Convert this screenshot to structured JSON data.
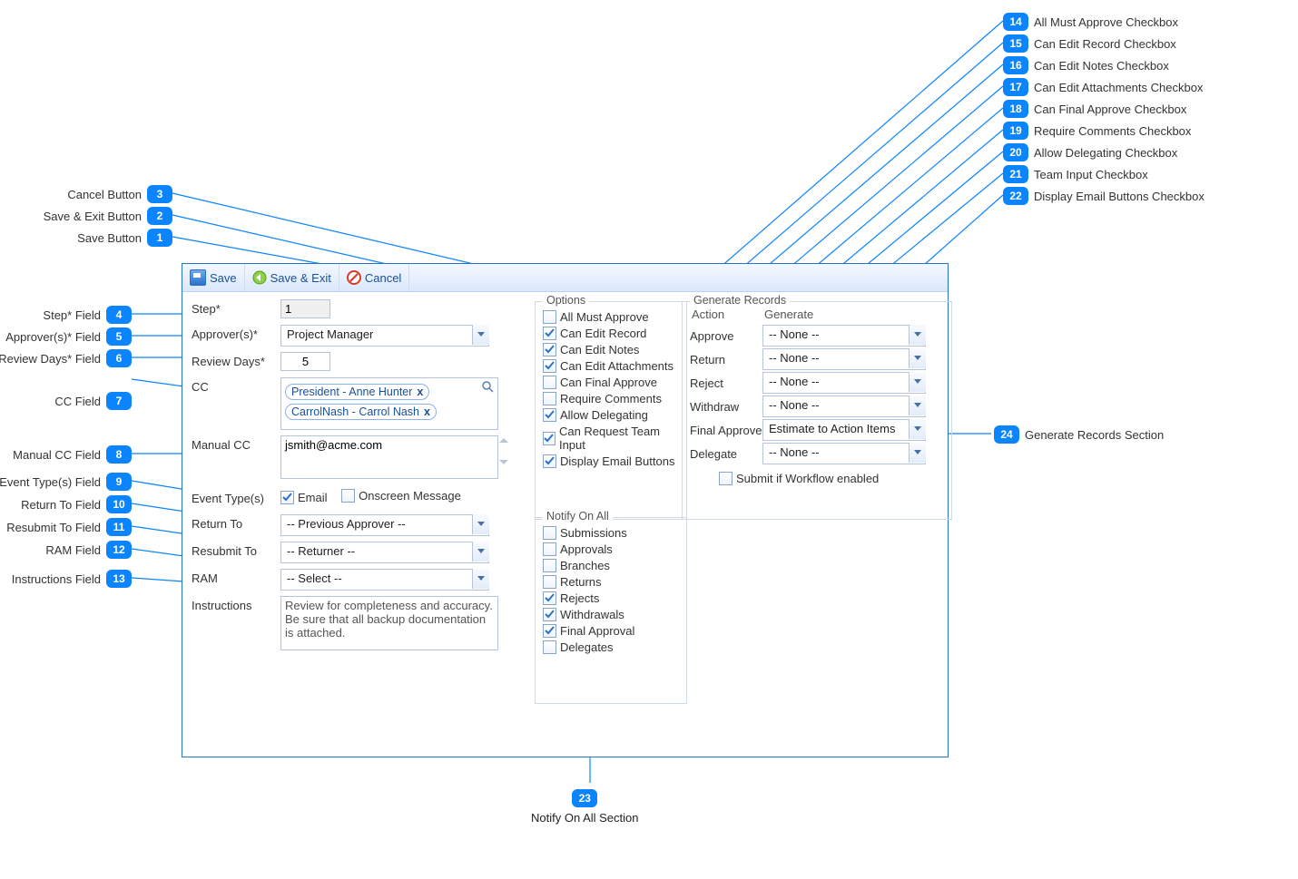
{
  "toolbar": {
    "save": "Save",
    "save_exit": "Save & Exit",
    "cancel": "Cancel"
  },
  "labels": {
    "step": "Step*",
    "approvers": "Approver(s)*",
    "review_days": "Review Days*",
    "cc": "CC",
    "manual_cc": "Manual CC",
    "event_types": "Event Type(s)",
    "return_to": "Return To",
    "resubmit_to": "Resubmit To",
    "ram": "RAM",
    "instructions": "Instructions"
  },
  "values": {
    "step": "1",
    "approvers": "Project Manager",
    "review_days": "5",
    "cc_tags": [
      "President - Anne Hunter",
      "CarrolNash - Carrol Nash"
    ],
    "manual_cc": "jsmith@acme.com",
    "event_email_label": "Email",
    "event_onscreen_label": "Onscreen Message",
    "event_email_checked": true,
    "event_onscreen_checked": false,
    "return_to": "-- Previous Approver --",
    "resubmit_to": "-- Returner --",
    "ram": "-- Select --",
    "instructions": "Review for completeness and accuracy. Be sure that all backup documentation is attached."
  },
  "options": {
    "legend": "Options",
    "items": [
      {
        "label": "All Must Approve",
        "checked": false
      },
      {
        "label": "Can Edit Record",
        "checked": true
      },
      {
        "label": "Can Edit Notes",
        "checked": true
      },
      {
        "label": "Can Edit Attachments",
        "checked": true
      },
      {
        "label": "Can Final Approve",
        "checked": false
      },
      {
        "label": "Require Comments",
        "checked": false
      },
      {
        "label": "Allow Delegating",
        "checked": true
      },
      {
        "label": "Can Request Team Input",
        "checked": true
      },
      {
        "label": "Display Email Buttons",
        "checked": true
      }
    ]
  },
  "notify": {
    "legend": "Notify On All",
    "items": [
      {
        "label": "Submissions",
        "checked": false
      },
      {
        "label": "Approvals",
        "checked": false
      },
      {
        "label": "Branches",
        "checked": false
      },
      {
        "label": "Returns",
        "checked": false
      },
      {
        "label": "Rejects",
        "checked": true
      },
      {
        "label": "Withdrawals",
        "checked": true
      },
      {
        "label": "Final Approval",
        "checked": true
      },
      {
        "label": "Delegates",
        "checked": false
      }
    ]
  },
  "genrec": {
    "legend": "Generate Records",
    "hdr_action": "Action",
    "hdr_generate": "Generate",
    "rows": [
      {
        "action": "Approve",
        "value": "-- None --"
      },
      {
        "action": "Return",
        "value": "-- None --"
      },
      {
        "action": "Reject",
        "value": "-- None --"
      },
      {
        "action": "Withdraw",
        "value": "-- None --"
      },
      {
        "action": "Final Approve",
        "value": "Estimate to Action Items Map"
      },
      {
        "action": "Delegate",
        "value": "-- None --"
      }
    ],
    "submit_label": "Submit if Workflow enabled",
    "submit_checked": false
  },
  "callouts": {
    "left": [
      {
        "n": "3",
        "label": "Cancel Button"
      },
      {
        "n": "2",
        "label": "Save & Exit Button"
      },
      {
        "n": "1",
        "label": "Save Button"
      },
      {
        "n": "4",
        "label": "Step* Field"
      },
      {
        "n": "5",
        "label": "Approver(s)* Field"
      },
      {
        "n": "6",
        "label": "Review Days* Field"
      },
      {
        "n": "7",
        "label": "CC Field"
      },
      {
        "n": "8",
        "label": "Manual CC Field"
      },
      {
        "n": "9",
        "label": "Event Type(s) Field"
      },
      {
        "n": "10",
        "label": "Return To Field"
      },
      {
        "n": "11",
        "label": "Resubmit To Field"
      },
      {
        "n": "12",
        "label": "RAM Field"
      },
      {
        "n": "13",
        "label": "Instructions Field"
      }
    ],
    "right": [
      {
        "n": "14",
        "label": "All Must Approve Checkbox"
      },
      {
        "n": "15",
        "label": "Can Edit Record Checkbox"
      },
      {
        "n": "16",
        "label": "Can Edit Notes Checkbox"
      },
      {
        "n": "17",
        "label": "Can Edit Attachments Checkbox"
      },
      {
        "n": "18",
        "label": "Can Final Approve Checkbox"
      },
      {
        "n": "19",
        "label": "Require Comments Checkbox"
      },
      {
        "n": "20",
        "label": "Allow Delegating Checkbox"
      },
      {
        "n": "21",
        "label": "Team Input Checkbox"
      },
      {
        "n": "22",
        "label": "Display Email Buttons Checkbox"
      },
      {
        "n": "24",
        "label": "Generate Records Section"
      }
    ],
    "bottom": {
      "n": "23",
      "label": "Notify On All Section"
    }
  }
}
